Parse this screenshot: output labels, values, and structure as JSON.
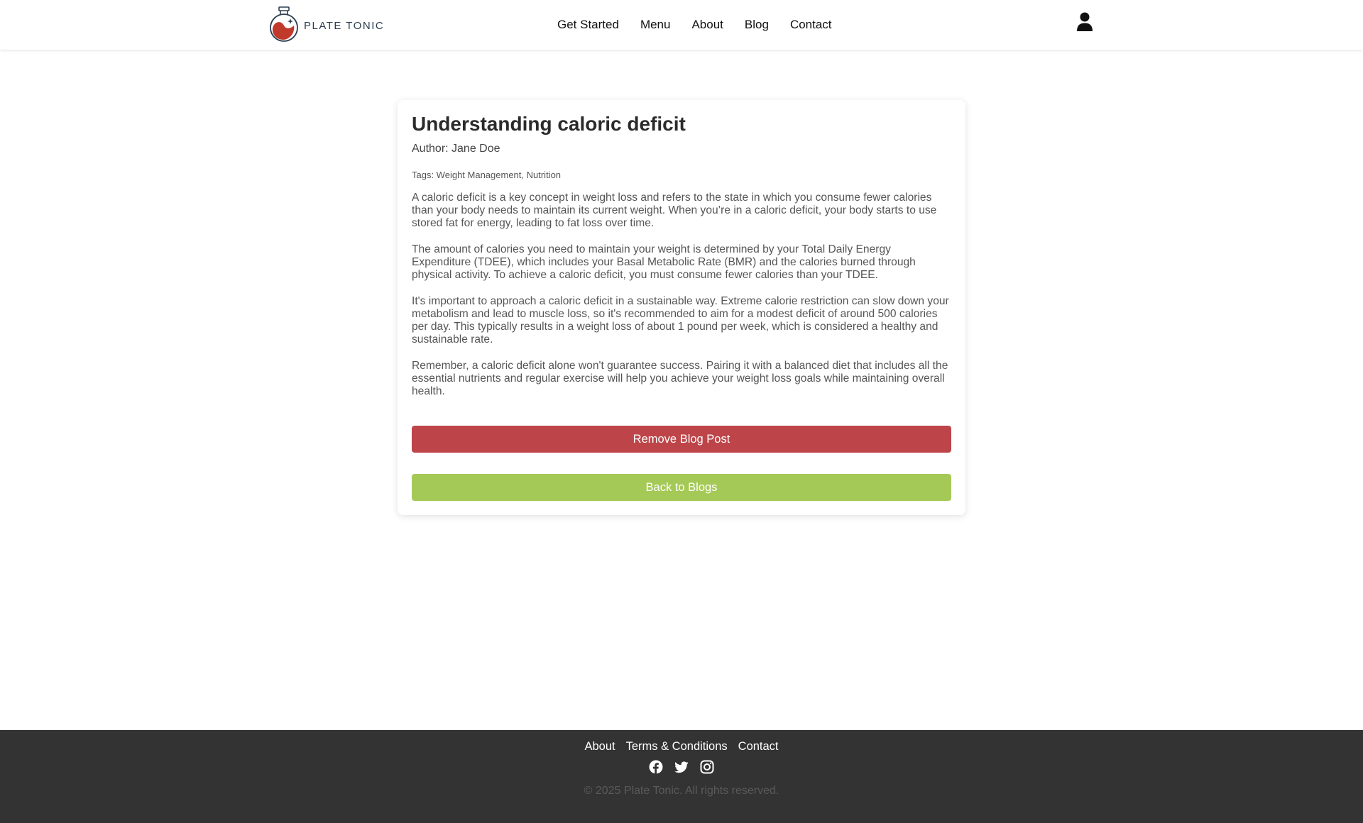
{
  "header": {
    "brand": "PLATE TONIC",
    "nav": [
      "Get Started",
      "Menu",
      "About",
      "Blog",
      "Contact"
    ],
    "user_icon": "user-icon"
  },
  "post": {
    "title": "Understanding caloric deficit",
    "author": "Author: Jane Doe",
    "tags": "Tags: Weight Management, Nutrition",
    "paragraphs": [
      "A caloric deficit is a key concept in weight loss and refers to the state in which you consume fewer calories than your body needs to maintain its current weight. When you’re in a caloric deficit, your body starts to use stored fat for energy, leading to fat loss over time.",
      "The amount of calories you need to maintain your weight is determined by your Total Daily Energy Expenditure (TDEE), which includes your Basal Metabolic Rate (BMR) and the calories burned through physical activity. To achieve a caloric deficit, you must consume fewer calories than your TDEE.",
      "It's important to approach a caloric deficit in a sustainable way. Extreme calorie restriction can slow down your metabolism and lead to muscle loss, so it's recommended to aim for a modest deficit of around 500 calories per day. This typically results in a weight loss of about 1 pound per week, which is considered a healthy and sustainable rate.",
      "Remember, a caloric deficit alone won't guarantee success. Pairing it with a balanced diet that includes all the essential nutrients and regular exercise will help you achieve your weight loss goals while maintaining overall health."
    ],
    "remove_label": "Remove Blog Post",
    "back_label": "Back to Blogs"
  },
  "footer": {
    "links": [
      "About",
      "Terms & Conditions",
      "Contact"
    ],
    "socials": [
      "facebook-icon",
      "twitter-icon",
      "instagram-icon"
    ],
    "copyright": "© 2025 Plate Tonic. All rights reserved."
  },
  "colors": {
    "remove": "#bd4549",
    "back": "#a5c956",
    "footer_bg": "#333333",
    "logo_red": "#c0392b",
    "logo_navy": "#2c3e50"
  }
}
